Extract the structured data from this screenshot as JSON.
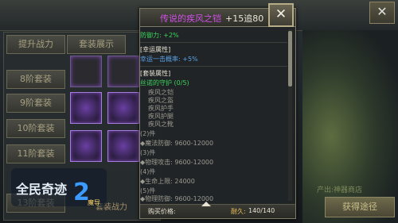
{
  "background": {
    "top_tabs": [
      "提升战力",
      "套装展示"
    ],
    "side_tabs": [
      "8阶套装",
      "9阶套装",
      "10阶套装",
      "11阶套装",
      "13阶套装"
    ],
    "bottom_caption": "套装战力",
    "right_caption": "产出:神器商店",
    "right_button": "获得途径",
    "logo_text": "全民奇迹",
    "logo_number": "2",
    "logo_badge": "魔导"
  },
  "tooltip": {
    "name": "传说的疾风之铠",
    "level": "+15追80",
    "close_symbol": "✕",
    "defense_line": "防御力: +2%",
    "luck_title": "[幸运属性]",
    "luck_line": "幸运一击概率: +5%",
    "set_title": "[套装属性]",
    "set_name": "丝诺的守护 (0/5)",
    "set_pieces": [
      "疾风之铠",
      "疾风之盔",
      "疾风护手",
      "疾风护腿",
      "疾风之靴"
    ],
    "bonuses": [
      {
        "count": "(2)件",
        "stat": "◆魔法防御: 9600-12000"
      },
      {
        "count": "(3)件",
        "stat": "◆物理攻击: 9600-12000"
      },
      {
        "count": "(4)件",
        "stat": "◆生命上限: 24000"
      },
      {
        "count": "(5)件",
        "stat": "◆物理防御: 9600-12000"
      }
    ],
    "price_label": "购买价格:",
    "durability_label": "耐久:",
    "durability_value": "140/140"
  }
}
